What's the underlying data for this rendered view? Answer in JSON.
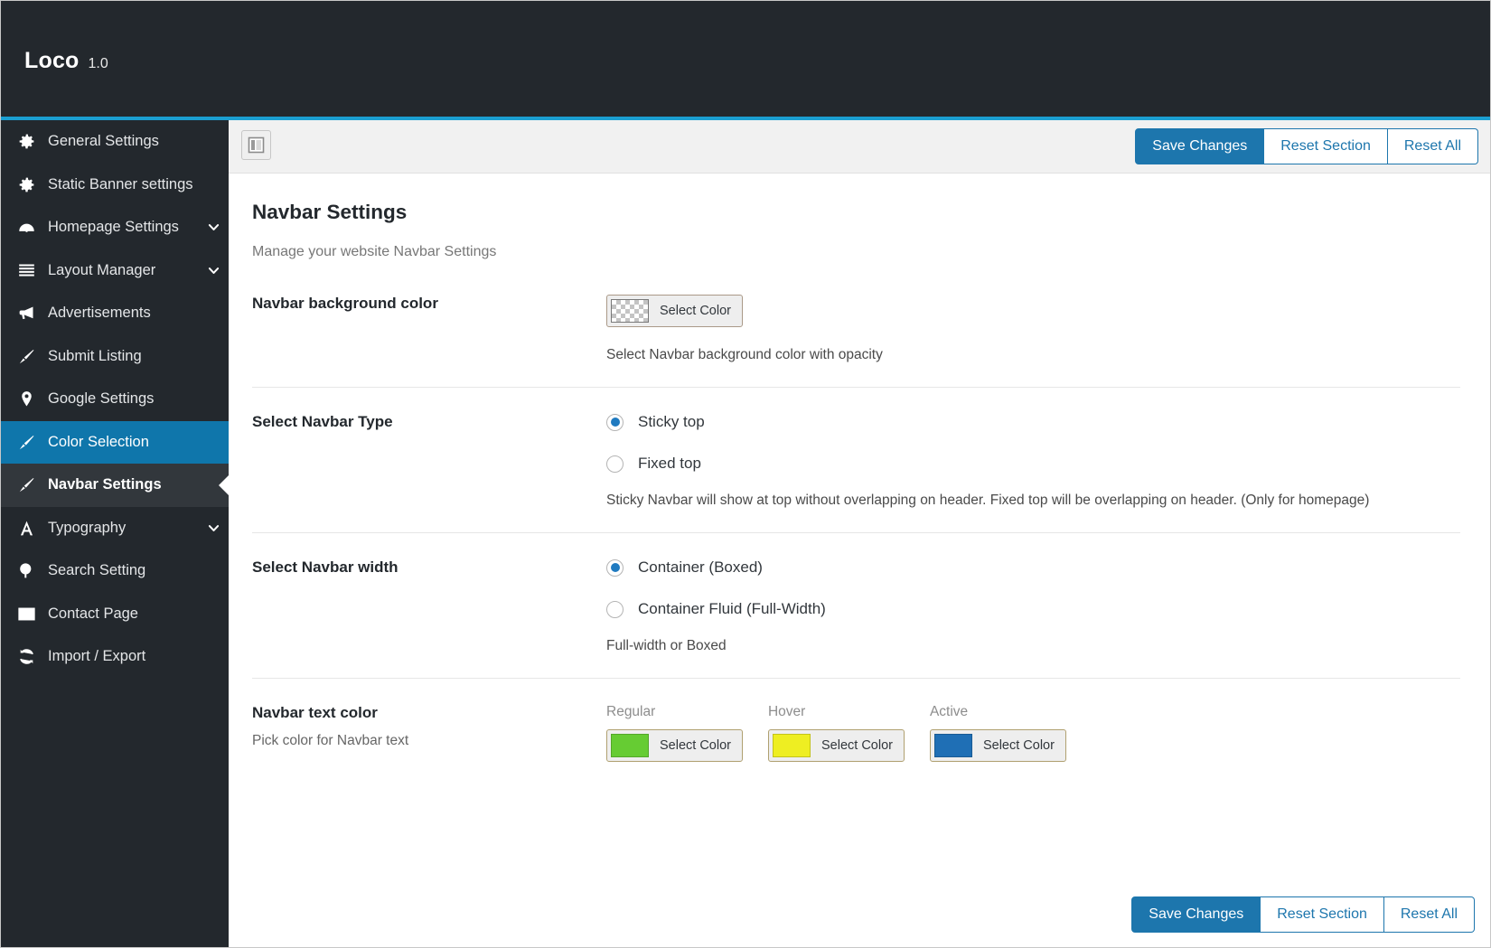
{
  "header": {
    "brand": "Loco",
    "version": "1.0",
    "accent_color": "#1b9fd1",
    "background_color": "#23282d"
  },
  "sidebar": {
    "items": [
      {
        "label": "General Settings",
        "icon": "gear-icon",
        "caret": "",
        "state": "normal"
      },
      {
        "label": "Static Banner settings",
        "icon": "gear-icon",
        "caret": "",
        "state": "normal"
      },
      {
        "label": "Homepage Settings",
        "icon": "gauge-icon",
        "caret": "chevron-down-icon",
        "state": "normal"
      },
      {
        "label": "Layout Manager",
        "icon": "layout-lines-icon",
        "caret": "chevron-down-icon",
        "state": "normal"
      },
      {
        "label": "Advertisements",
        "icon": "megaphone-icon",
        "caret": "",
        "state": "normal"
      },
      {
        "label": "Submit Listing",
        "icon": "brush-icon",
        "caret": "",
        "state": "normal"
      },
      {
        "label": "Google Settings",
        "icon": "map-pin-icon",
        "caret": "",
        "state": "normal"
      },
      {
        "label": "Color Selection",
        "icon": "brush-icon",
        "caret": "",
        "state": "selected"
      },
      {
        "label": "Navbar Settings",
        "icon": "brush-icon",
        "caret": "",
        "state": "active"
      },
      {
        "label": "Typography",
        "icon": "letter-a-icon",
        "caret": "chevron-down-icon",
        "state": "normal"
      },
      {
        "label": "Search Setting",
        "icon": "magnifier-icon",
        "caret": "",
        "state": "normal"
      },
      {
        "label": "Contact Page",
        "icon": "envelope-icon",
        "caret": "",
        "state": "normal"
      },
      {
        "label": "Import / Export",
        "icon": "refresh-icon",
        "caret": "",
        "state": "normal"
      }
    ],
    "selected_color": "#0f76ab",
    "active_color": "#32373c"
  },
  "toolbar": {
    "panel_toggle_icon": "sidebar-toggle-icon",
    "save_label": "Save Changes",
    "reset_section_label": "Reset Section",
    "reset_all_label": "Reset All",
    "primary_color": "#1d76ad"
  },
  "main": {
    "title": "Navbar Settings",
    "subtitle": "Manage your website Navbar Settings",
    "fields": {
      "background_color": {
        "label": "Navbar background color",
        "button_label": "Select Color",
        "swatch": "transparent",
        "help": "Select Navbar background color with opacity"
      },
      "navbar_type": {
        "label": "Select Navbar Type",
        "options": [
          {
            "label": "Sticky top",
            "checked": true
          },
          {
            "label": "Fixed top",
            "checked": false
          }
        ],
        "help": "Sticky Navbar will show at top without overlapping on header. Fixed top will be overlapping on header. (Only for homepage)"
      },
      "navbar_width": {
        "label": "Select Navbar width",
        "options": [
          {
            "label": "Container (Boxed)",
            "checked": true
          },
          {
            "label": "Container Fluid (Full-Width)",
            "checked": false
          }
        ],
        "help": "Full-width or Boxed"
      },
      "text_color": {
        "label": "Navbar text color",
        "sub": "Pick color for Navbar text",
        "pickers": [
          {
            "state_label": "Regular",
            "button_label": "Select Color",
            "color": "#66cc33"
          },
          {
            "state_label": "Hover",
            "button_label": "Select Color",
            "color": "#eeee22"
          },
          {
            "state_label": "Active",
            "button_label": "Select Color",
            "color": "#1f6fb5"
          }
        ]
      }
    }
  },
  "footer": {
    "save_label": "Save Changes",
    "reset_section_label": "Reset Section",
    "reset_all_label": "Reset All"
  }
}
